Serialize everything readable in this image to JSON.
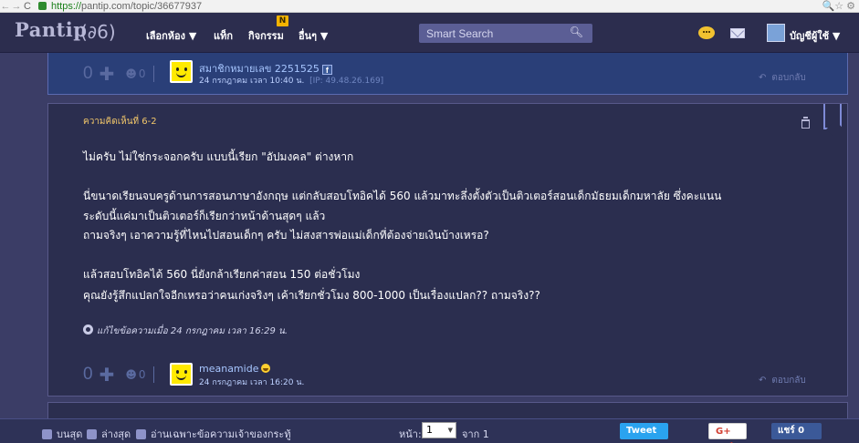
{
  "browser": {
    "back_glyph": "←",
    "forward_glyph": "→",
    "reload_glyph": "C",
    "url_scheme": "https://",
    "url_rest": "pantip.com/topic/36677937",
    "right_icons": "🔍☆ ⚙"
  },
  "nav": {
    "logo": "Pantip",
    "logo_mark": "(∂6)",
    "items": [
      "เลือกห้อง ▼",
      "แท็ก",
      "กิจกรรม",
      "อื่นๆ ▼"
    ],
    "new_badge": "N",
    "search_placeholder": "Smart Search",
    "account": "บัญชีผู้ใช้ ▼"
  },
  "reply_comment": {
    "votes": "0",
    "plus": "✚",
    "emo_icon": "☻",
    "emo_count": "0",
    "member_name": "สมาชิกหมายเลข 2251525",
    "fb": "f",
    "date": "24 กรกฎาคม เวลา 10:40 น.",
    "ip": "[IP: 49.48.26.169]",
    "reply_label": "ตอบกลับ",
    "reply_arrow": "↶"
  },
  "main_comment": {
    "title": "ความคิดเห็นที่ 6-2",
    "p1": "ไม่ครับ  ไม่ใช่กระจอกครับ แบบนี้เรียก \"อัปมงคล\" ต่างหาก",
    "p2_line1": "นี่ขนาดเรียนจบครูด้านการสอนภาษาอังกฤษ แต่กลับสอบโทอิคได้ 560 แล้วมาทะลึ่งตั้งตัวเป็นติวเตอร์สอนเด็กมัธยมเด็กมหาลัย ซึ่งคะแนน",
    "p2_line2": "ระดับนี้แค่มาเป็นติวเตอร์ก็เรียกว่าหน้าด้านสุดๆ แล้ว",
    "p2_line3": "ถามจริงๆ เอาความรู้ที่ไหนไปสอนเด็กๆ ครับ ไม่สงสารพ่อแม่เด็กที่ต้องจ่ายเงินบ้างเหรอ?",
    "p3_line1": "แล้วสอบโทอิคได้ 560 นี่ยังกล้าเรียกค่าสอน 150 ต่อชั่วโมง",
    "p3_line2": "คุณยังรู้สึกแปลกใจอีกเหรอว่าคนเก่งจริงๆ เค้าเรียกชั่วโมง 800-1000 เป็นเรื่องแปลก??  ถามจริง??",
    "edit_note": "แก้ไขข้อความเมื่อ 24 กรกฎาคม เวลา 16:29 น.",
    "votes": "0",
    "plus": "✚",
    "emo_icon": "☻",
    "emo_count": "0",
    "member_name": "meanamide",
    "date": "24 กรกฎาคม เวลา 16:20 น.",
    "reply_label": "ตอบกลับ",
    "reply_arrow": "↶"
  },
  "bottom": {
    "top_label": "บนสุด",
    "bottom_label": "ล่างสุด",
    "owner_only": "อ่านเฉพาะข้อความเจ้าของกระทู้",
    "page_label": "หน้า:",
    "page_value": "1",
    "of_label": "จาก 1",
    "tweet": "Tweet",
    "gplus": "G+ แชร์",
    "fb_share": "แชร์ 0"
  },
  "colors": {
    "background": "#3b3d66",
    "nav": "#2c2d4e",
    "reply_box": "#2a3f78",
    "comment_box": "#2b2e4f",
    "title_accent": "#f1c66a",
    "tweet": "#2aa3ef",
    "facebook": "#3b5998"
  }
}
